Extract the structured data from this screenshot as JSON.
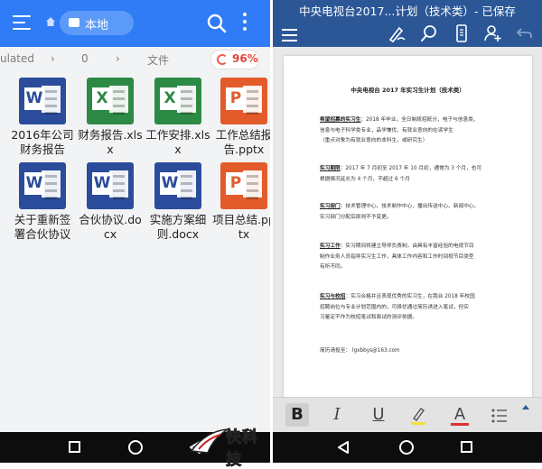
{
  "file_manager": {
    "location_label": "本地",
    "breadcrumb": [
      "ulated",
      "0",
      "文件"
    ],
    "storage_percent": "96%",
    "files": [
      {
        "name": "2016年公司财务报告",
        "type": "word",
        "letter": "W"
      },
      {
        "name": "财务报告.xlsx",
        "type": "excel",
        "letter": "X"
      },
      {
        "name": "工作安排.xlsx",
        "type": "excel",
        "letter": "X"
      },
      {
        "name": "工作总结报告.pptx",
        "type": "ppt",
        "letter": "P"
      },
      {
        "name": "关于重新签署合伙协议",
        "type": "word",
        "letter": "W"
      },
      {
        "name": "合伙协议.docx",
        "type": "word",
        "letter": "W"
      },
      {
        "name": "实施方案细则.docx",
        "type": "word",
        "letter": "W"
      },
      {
        "name": "项目总结.pptx",
        "type": "ppt",
        "letter": "P"
      }
    ]
  },
  "doc_viewer": {
    "title": "中央电视台2017...计划（技术类）- 已保存",
    "heading": "中央电视台 2017 年实习生计划（技术类）",
    "paragraphs": [
      {
        "label": "希望招募的实习生",
        "lines": [
          "：2018 年毕业，全日制統招統分，电子与信息类、",
          "信息与电子科学类专业，品学兼优，有就业意向的在读学生",
          "（重点对象为有就业意向的本科生，或研究生）"
        ]
      },
      {
        "label": "实习期限",
        "lines": [
          "：2017 年 7 月初至 2017 年 10 月初，通常为 3 个月，也可",
          "根据情况延长为 4 个月，不超过 6 个月"
        ]
      },
      {
        "label": "实习部门",
        "lines": [
          "：技术管理中心、技术制作中心、播出传送中心、新闻中心。",
          "实习部门分配后原则不予变更。"
        ]
      },
      {
        "label": "实习工作",
        "lines": [
          "：实习期间将建立导师负责制，由具有丰富经验的电视节目",
          "制作业务人员指导实习生工作，具体工作内容和工作时间视节目类型",
          "有所不同。"
        ]
      },
      {
        "label": "实习与校招",
        "lines": [
          "：实习合格并且表现优秀的实习生，在我台 2018 年校园",
          "招聘岗位与专业计划范围内的，可择优通过简历诱进入笔试，但实",
          "习鉴定不作为校招笔试和面试的测评依据。"
        ]
      },
      {
        "label": "",
        "lines": [
          "简历请投至：  lgxbbys@163.com"
        ]
      }
    ],
    "format_buttons": [
      "B",
      "I",
      "U",
      "A"
    ]
  },
  "watermark": "快科技",
  "colors": {
    "fm_bar": "#2f7cf6",
    "doc_bar": "#2b5797",
    "word": "#2b4c9b",
    "excel": "#2d8a45",
    "ppt": "#e35b2b",
    "badge": "#e0483b"
  }
}
